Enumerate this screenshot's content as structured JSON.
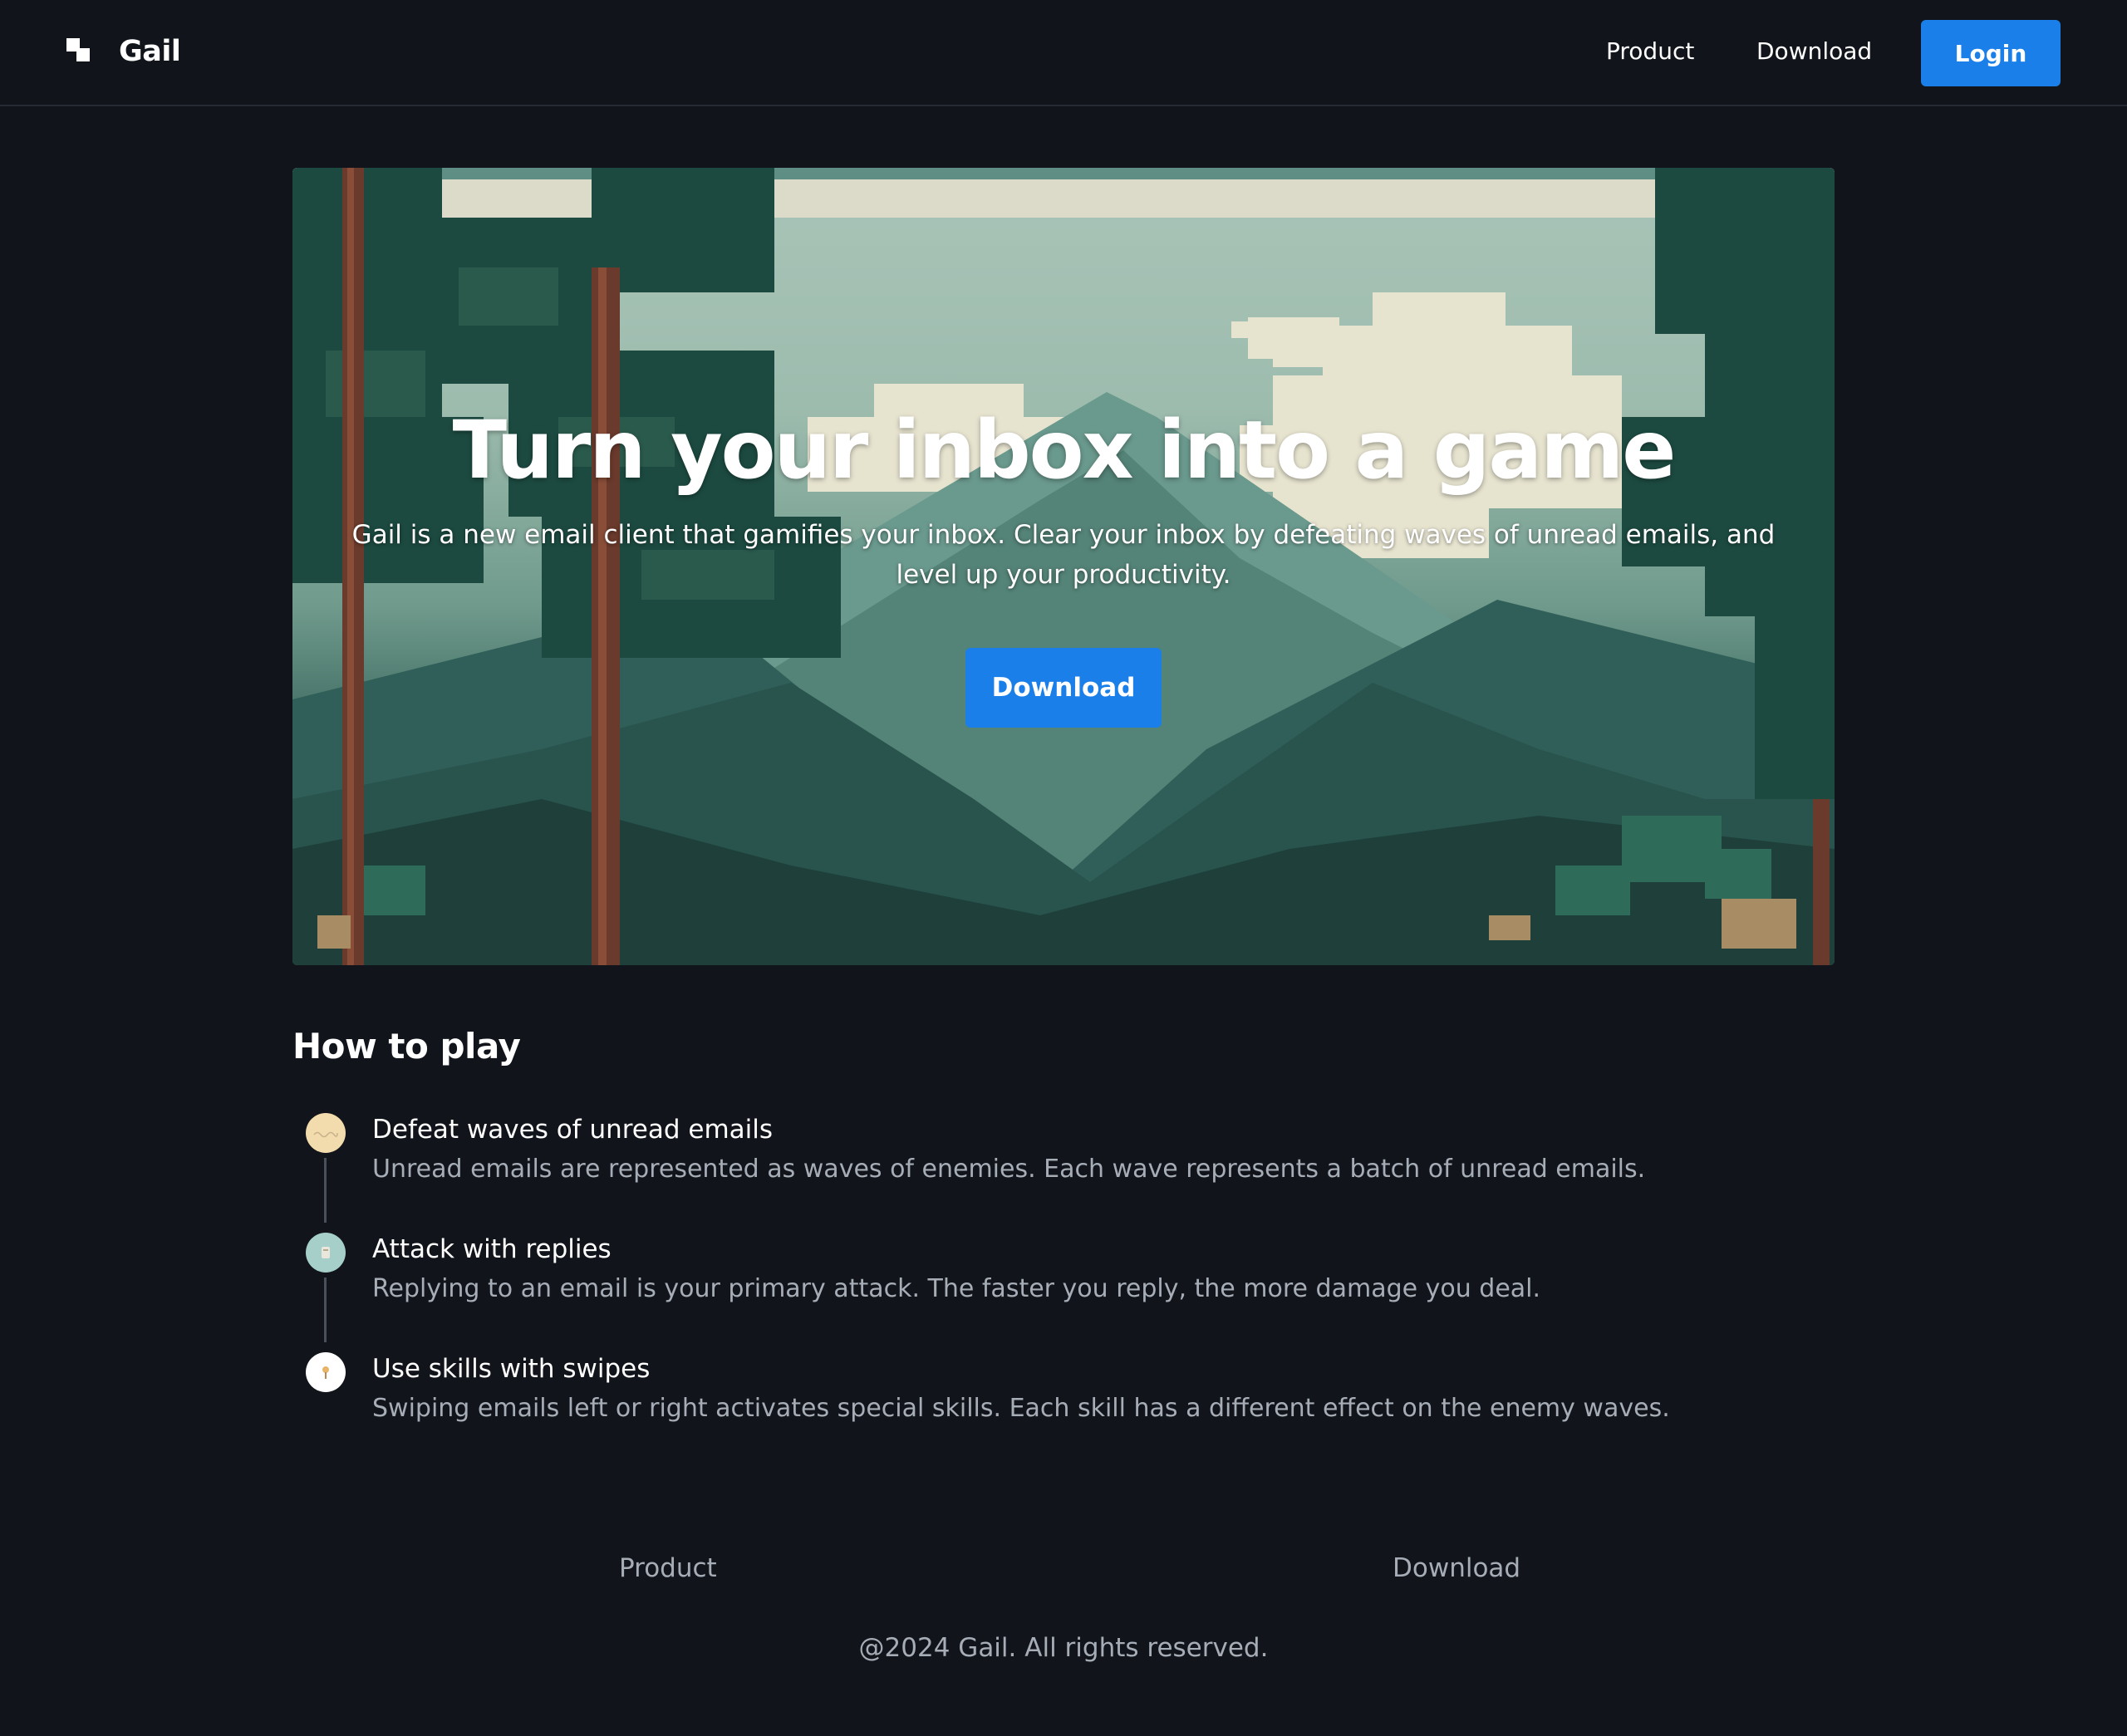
{
  "header": {
    "brand": "Gail",
    "nav": {
      "product": "Product",
      "download": "Download"
    },
    "login_label": "Login"
  },
  "hero": {
    "title": "Turn your inbox into a game",
    "subtitle": "Gail is a new email client that gamifies your inbox. Clear your inbox by defeating waves of unread emails, and level up your productivity.",
    "button_label": "Download"
  },
  "how_to_play": {
    "title": "How to play",
    "steps": [
      {
        "title": "Defeat waves of unread emails",
        "description": "Unread emails are represented as waves of enemies. Each wave represents a batch of unread emails.",
        "icon": "wave-icon"
      },
      {
        "title": "Attack with replies",
        "description": "Replying to an email is your primary attack. The faster you reply, the more damage you deal.",
        "icon": "attack-icon"
      },
      {
        "title": "Use skills with swipes",
        "description": "Swiping emails left or right activates special skills. Each skill has a different effect on the enemy waves.",
        "icon": "skill-icon"
      }
    ]
  },
  "footer": {
    "links": {
      "product": "Product",
      "download": "Download"
    },
    "copyright": "@2024 Gail. All rights reserved."
  },
  "colors": {
    "background": "#11151b",
    "accent": "#1a7fe8",
    "muted_text": "#a7adb6"
  }
}
